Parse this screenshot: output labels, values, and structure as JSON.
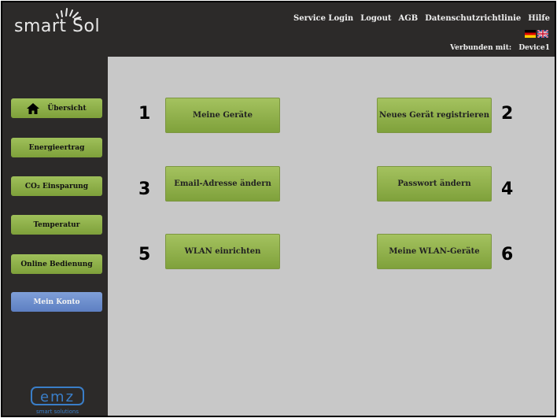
{
  "header": {
    "logo_text": "smart Sol",
    "links": [
      "Service Login",
      "Logout",
      "AGB",
      "Datenschutzrichtlinie",
      "Hilfe"
    ],
    "connected_label": "Verbunden mit:",
    "device": "Device1"
  },
  "sidebar": {
    "items": [
      {
        "label": "Übersicht"
      },
      {
        "label": "Energieertrag"
      },
      {
        "label": "CO₂ Einsparung"
      },
      {
        "label": "Temperatur"
      },
      {
        "label": "Online Bedienung"
      },
      {
        "label": "Mein Konto"
      }
    ],
    "footer_logo": "emz",
    "footer_tagline": "smart solutions"
  },
  "main": {
    "buttons": [
      {
        "num": "1",
        "label": "Meine Geräte"
      },
      {
        "num": "2",
        "label": "Neues Gerät registrieren"
      },
      {
        "num": "3",
        "label": "Email-Adresse ändern"
      },
      {
        "num": "4",
        "label": "Passwort ändern"
      },
      {
        "num": "5",
        "label": "WLAN einrichten"
      },
      {
        "num": "6",
        "label": "Meine WLAN-Geräte"
      }
    ]
  },
  "colors": {
    "header_bg": "#2c2a29",
    "content_bg": "#c8c8c8",
    "button_green": "#8fb04a",
    "account_blue": "#6b8ccc"
  }
}
